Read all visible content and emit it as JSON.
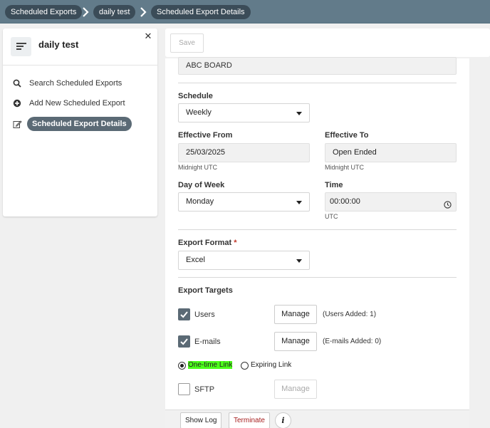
{
  "breadcrumb": {
    "items": [
      "Scheduled Exports",
      "daily test",
      "Scheduled Export Details"
    ]
  },
  "left_panel": {
    "title": "daily test",
    "close_glyph": "✕",
    "items": [
      {
        "label": "Search Scheduled Exports",
        "icon": "search-icon"
      },
      {
        "label": "Add New Scheduled Export",
        "icon": "plus-circle-icon"
      },
      {
        "label": "Scheduled Export Details",
        "icon": "edit-icon",
        "active": true
      }
    ]
  },
  "toolbar": {
    "save_label": "Save"
  },
  "form": {
    "board_value": "ABC BOARD",
    "schedule": {
      "label": "Schedule",
      "value": "Weekly"
    },
    "effective_from": {
      "label": "Effective From",
      "value": "25/03/2025",
      "note": "Midnight UTC"
    },
    "effective_to": {
      "label": "Effective To",
      "value": "Open Ended",
      "note": "Midnight UTC"
    },
    "day_of_week": {
      "label": "Day of Week",
      "value": "Monday"
    },
    "time": {
      "label": "Time",
      "value": "00:00:00",
      "note": "UTC"
    },
    "export_format": {
      "label": "Export Format",
      "required_mark": "*",
      "value": "Excel"
    },
    "export_targets": {
      "label": "Export Targets",
      "users": {
        "label": "Users",
        "checked": true,
        "button": "Manage",
        "note": "(Users Added: 1)"
      },
      "emails": {
        "label": "E-mails",
        "checked": true,
        "button": "Manage",
        "note": "(E-mails Added: 0)"
      },
      "link_options": [
        {
          "label": "One-time Link",
          "selected": true
        },
        {
          "label": "Expiring Link",
          "selected": false
        }
      ],
      "sftp": {
        "label": "SFTP",
        "checked": false,
        "button": "Manage"
      }
    }
  },
  "footer": {
    "show_log_label": "Show Log",
    "terminate_label": "Terminate",
    "info_glyph": "i"
  },
  "colors": {
    "topbar": "#627b8a",
    "crumb_bg": "#3b4c58",
    "checkbox_checked": "#5b6a75",
    "link_highlight": "#4dff1a",
    "terminate_text": "#a72020"
  }
}
